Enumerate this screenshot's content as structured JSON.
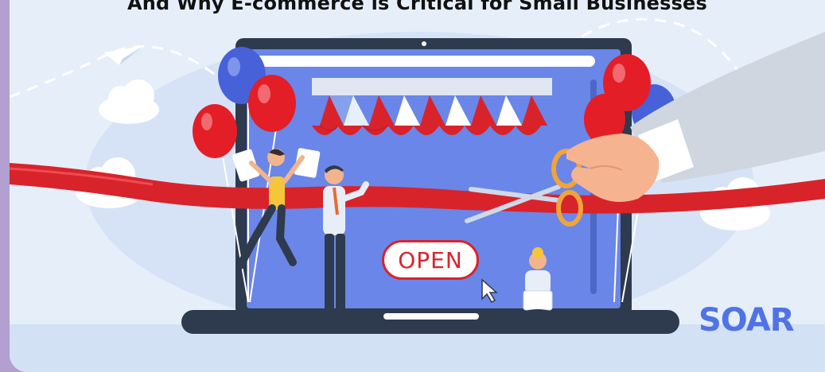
{
  "headline": "And Why E-commerce is Critical for Small Businesses",
  "sign": {
    "text": "OPEN"
  },
  "brand": {
    "name": "SOAR"
  },
  "colors": {
    "background": "#e6eefa",
    "frame": "#b39fd0",
    "screen": "#6a86e8",
    "laptop": "#2e3a4d",
    "ribbon": "#d9232b",
    "brand": "#4f73e6"
  },
  "illustration": {
    "icons": [
      "paper-plane-icon",
      "cloud-icon",
      "balloon-icon",
      "awning-icon",
      "cursor-icon",
      "scissors-icon",
      "hand-icon"
    ]
  }
}
